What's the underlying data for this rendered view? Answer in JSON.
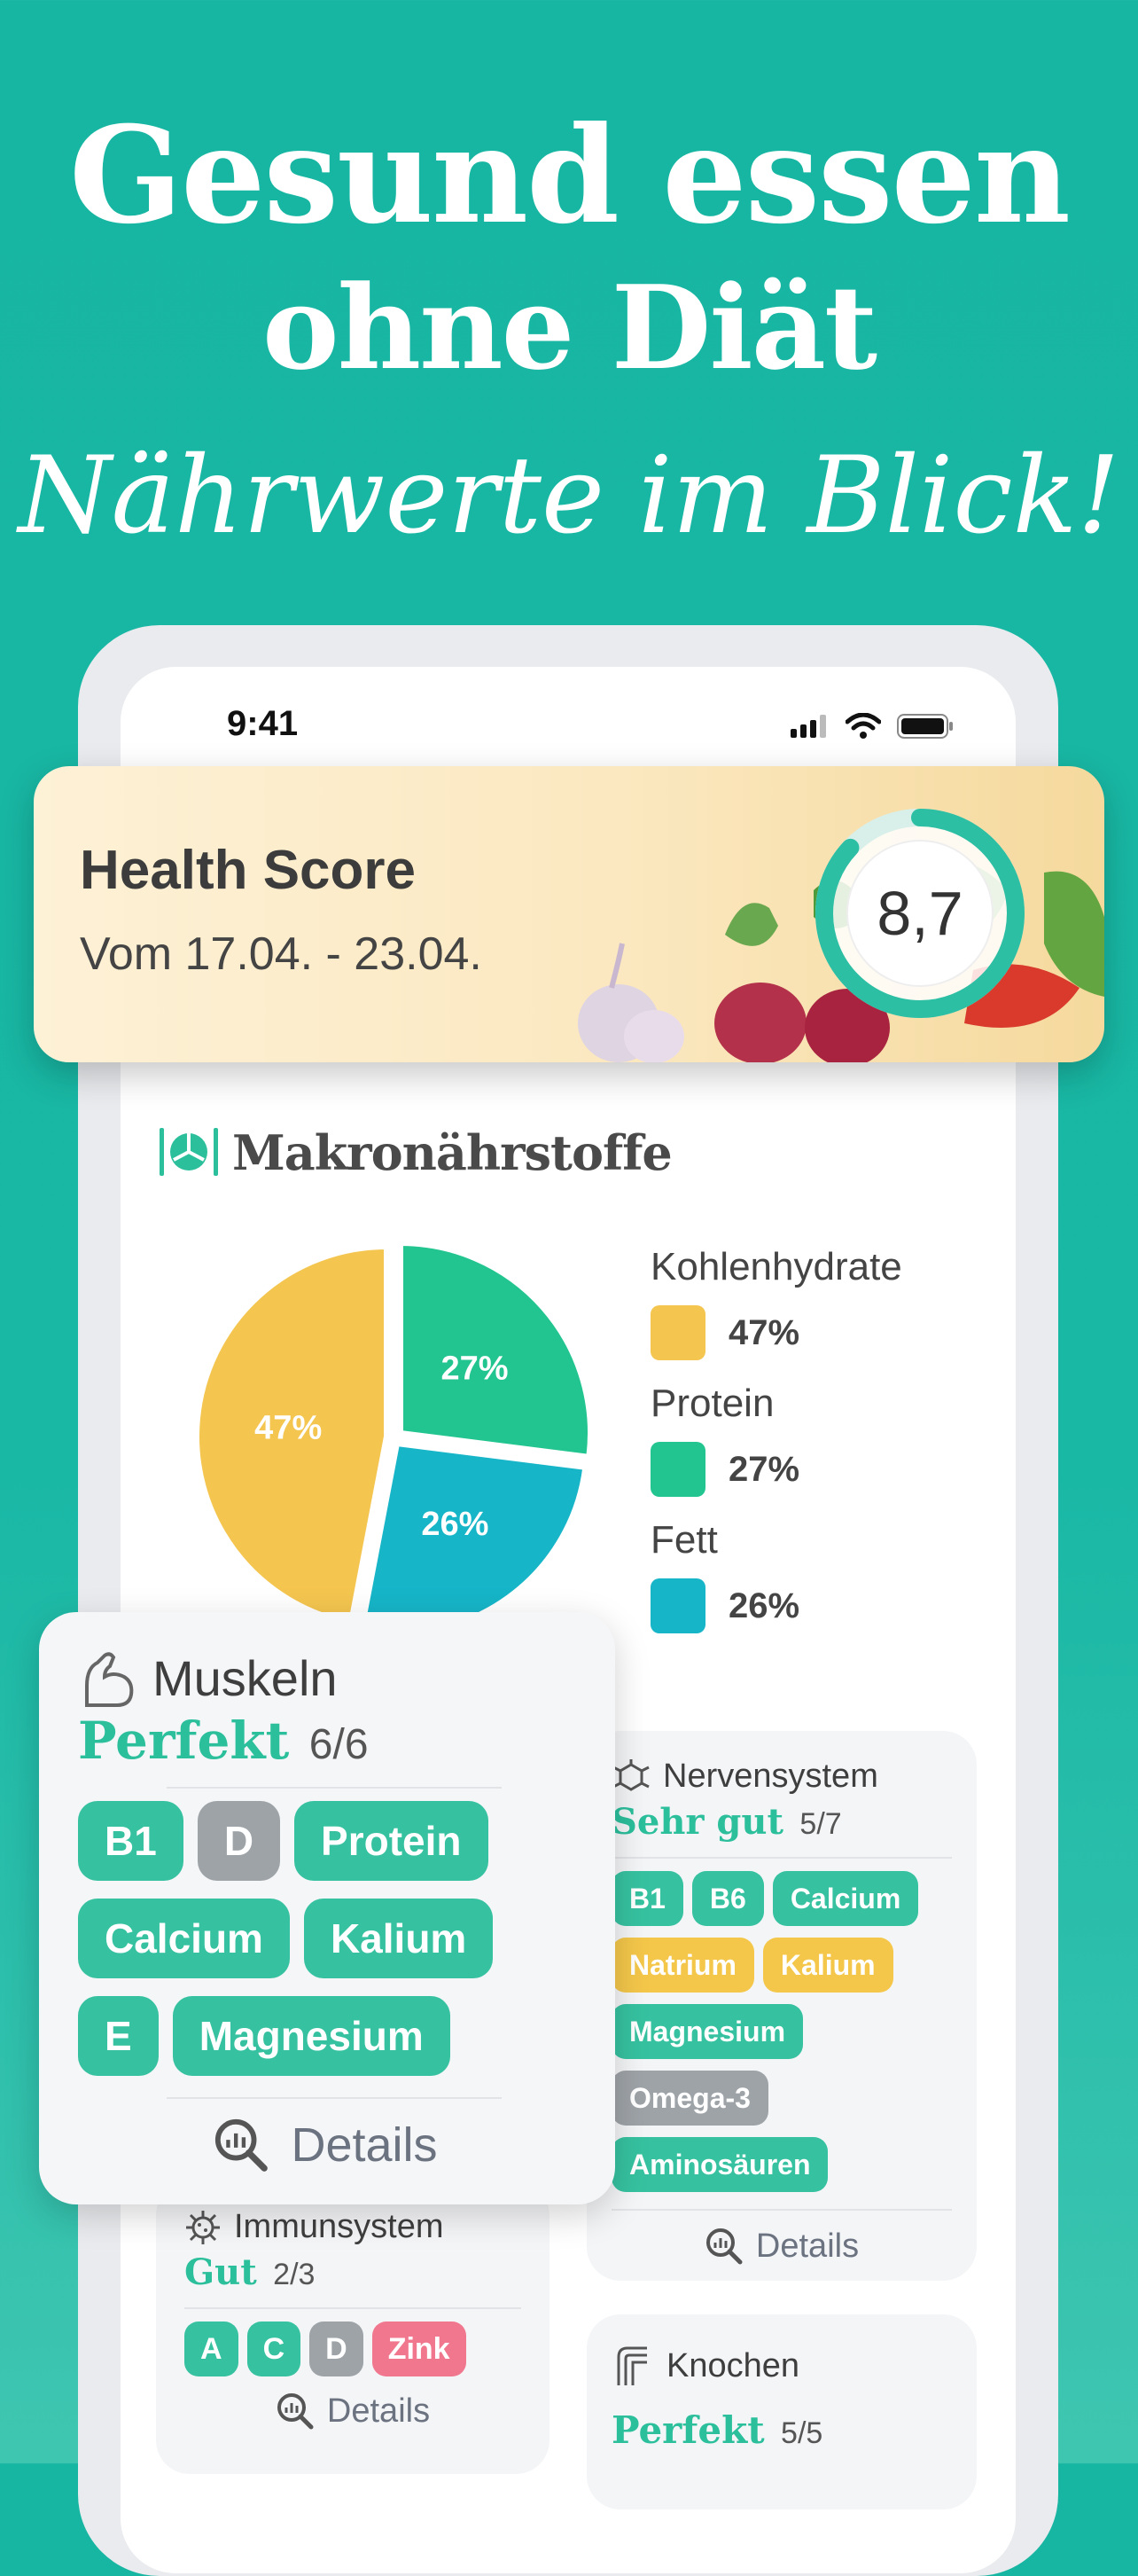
{
  "headline": {
    "line1": "Gesund essen",
    "line2": "ohne Diät",
    "tagline": "Nährwerte im Blick!"
  },
  "status_bar": {
    "time": "9:41",
    "icons": [
      "signal-icon",
      "wifi-icon",
      "battery-icon"
    ]
  },
  "health_score": {
    "title": "Health Score",
    "subtitle": "Vom 17.04. - 23.04.",
    "value": "8,7",
    "progress": 0.87
  },
  "macros": {
    "title": "Makronährstoffe",
    "icon": "plate-cutlery-icon",
    "chart_data": {
      "type": "pie",
      "categories": [
        "Kohlenhydrate",
        "Protein",
        "Fett"
      ],
      "values": [
        47,
        27,
        26
      ],
      "labels": [
        "47%",
        "27%",
        "26%"
      ],
      "colors": [
        "#f4c54f",
        "#22c58f",
        "#16b5c8"
      ]
    },
    "legend": [
      {
        "name": "Kohlenhydrate",
        "pct": "47%",
        "color": "#f4c54f"
      },
      {
        "name": "Protein",
        "pct": "27%",
        "color": "#22c58f"
      },
      {
        "name": "Fett",
        "pct": "26%",
        "color": "#16b5c8"
      }
    ]
  },
  "cards": {
    "muskeln": {
      "name": "Muskeln",
      "icon": "muscle-icon",
      "rating": "Perfekt",
      "ratio": "6/6",
      "tags": [
        "B1",
        "D",
        "Protein",
        "Calcium",
        "Kalium",
        "E",
        "Magnesium"
      ],
      "details": "Details"
    },
    "nervensystem": {
      "name": "Nervensystem",
      "icon": "neuron-icon",
      "rating": "Sehr gut",
      "ratio": "5/7",
      "tags": [
        "B1",
        "B6",
        "Calcium",
        "Natrium",
        "Kalium",
        "Magnesium",
        "Omega-3",
        "Aminosäuren"
      ],
      "details": "Details"
    },
    "immunsystem": {
      "name": "Immunsystem",
      "icon": "virus-icon",
      "rating": "Gut",
      "ratio": "2/3",
      "tags": [
        "A",
        "C",
        "D",
        "Zink"
      ],
      "details": "Details"
    },
    "knochen": {
      "name": "Knochen",
      "icon": "bone-icon",
      "rating": "Perfekt",
      "ratio": "5/5"
    }
  }
}
